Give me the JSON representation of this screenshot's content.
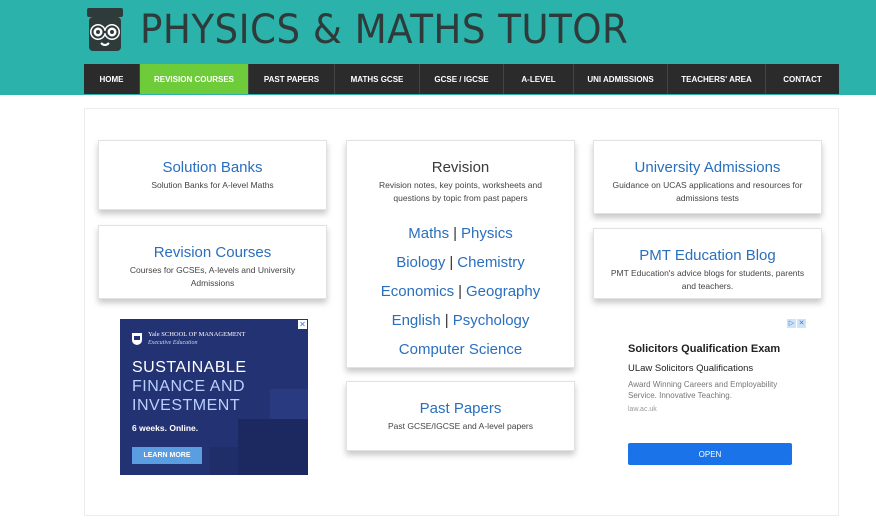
{
  "site": {
    "title": "PHYSICS & MATHS TUTOR",
    "logo_icon": "owl-logo-icon",
    "header_color": "#2bb3ab"
  },
  "nav": {
    "items": [
      {
        "label": "HOME"
      },
      {
        "label": "REVISION COURSES",
        "active": true
      },
      {
        "label": "PAST PAPERS"
      },
      {
        "label": "MATHS GCSE"
      },
      {
        "label": "GCSE / IGCSE"
      },
      {
        "label": "A-LEVEL"
      },
      {
        "label": "UNI ADMISSIONS"
      },
      {
        "label": "TEACHERS' AREA"
      },
      {
        "label": "CONTACT"
      }
    ]
  },
  "cards": {
    "solution_banks": {
      "title": "Solution Banks",
      "desc": "Solution Banks for A-level Maths"
    },
    "revision_courses": {
      "title": "Revision Courses",
      "desc": "Courses for GCSEs, A-levels and University Admissions"
    },
    "revision": {
      "title": "Revision",
      "desc": "Revision notes, key points, worksheets and questions by topic from past papers",
      "links": [
        [
          "Maths",
          "Physics"
        ],
        [
          "Biology",
          "Chemistry"
        ],
        [
          "Economics",
          "Geography"
        ],
        [
          "English",
          "Psychology"
        ],
        [
          "Computer Science"
        ]
      ],
      "separator": "|"
    },
    "past_papers": {
      "title": "Past Papers",
      "desc": "Past GCSE/IGCSE and A-level papers"
    },
    "university_admissions": {
      "title": "University Admissions",
      "desc": "Guidance on UCAS applications and resources for admissions tests"
    },
    "pmt_blog": {
      "title": "PMT Education Blog",
      "desc": "PMT Education's advice blogs for students, parents and teachers."
    }
  },
  "ad_left": {
    "brand": "Yale SCHOOL OF MANAGEMENT",
    "brand_sub": "Executive Education",
    "line1": "SUSTAINABLE",
    "line2": "FINANCE AND",
    "line3": "INVESTMENT",
    "duration": "6 weeks. Online.",
    "button": "LEARN MORE",
    "close": "✕"
  },
  "ad_right": {
    "title": "Solicitors Qualification Exam",
    "subtitle": "ULaw Solicitors Qualifications",
    "desc": "Award Winning Careers and Employability Service. Innovative Teaching.",
    "url": "law.ac.uk",
    "button": "OPEN",
    "choices_icon": "ad-choices-icon",
    "close": "✕"
  }
}
